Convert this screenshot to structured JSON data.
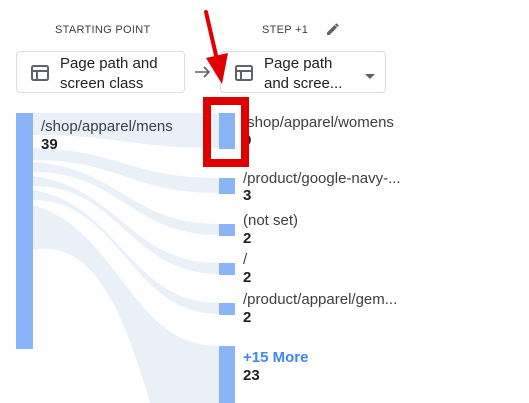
{
  "columns": {
    "starting_point": {
      "header": "STARTING POINT",
      "dimension_line1": "Page path and",
      "dimension_line2": "screen class"
    },
    "step": {
      "header": "STEP +1",
      "dimension_line1": "Page path",
      "dimension_line2": "and scree..."
    }
  },
  "source_node": {
    "label": "/shop/apparel/mens",
    "value": "39"
  },
  "step_nodes": [
    {
      "label": "/shop/apparel/womens",
      "value": "9"
    },
    {
      "label": "/product/google-navy-...",
      "value": "3"
    },
    {
      "label": "(not set)",
      "value": "2"
    },
    {
      "label": "/",
      "value": "2"
    },
    {
      "label": "/product/apparel/gem...",
      "value": "2"
    },
    {
      "label": "+15 More",
      "value": "23"
    }
  ],
  "colors": {
    "node": "#8ab4f8",
    "flow": "#e8eef7",
    "more_link": "#4285f4",
    "highlight": "#e00000"
  },
  "icons": [
    "table-icon",
    "arrow-right-icon",
    "pencil-icon",
    "caret-down-icon",
    "red-arrow-icon"
  ]
}
